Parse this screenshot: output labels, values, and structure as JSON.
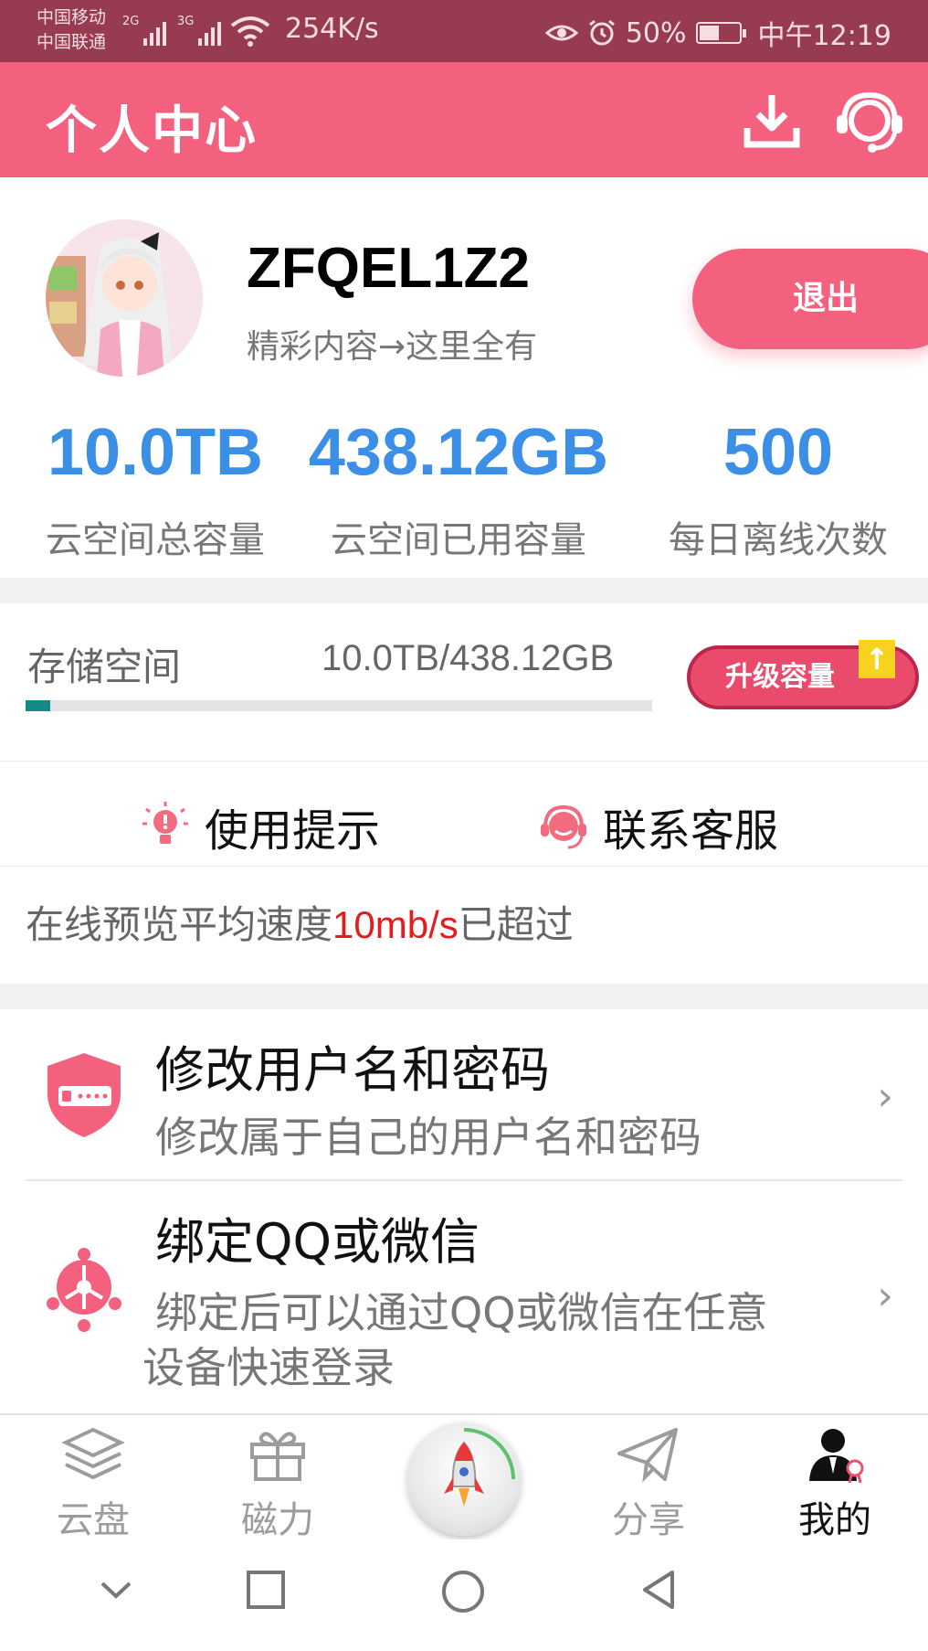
{
  "status_bar": {
    "carrier1": "中国移动",
    "carrier2": "中国联通",
    "net1": "2G",
    "net2": "3G",
    "speed": "254K/s",
    "battery": "50%",
    "time": "中午12:19"
  },
  "header": {
    "title": "个人中心",
    "icons": [
      "download-icon",
      "customer-service-icon"
    ]
  },
  "profile": {
    "username": "ZFQEL1Z2",
    "slogan": "精彩内容→这里全有",
    "logout_label": "退出"
  },
  "stats": [
    {
      "value": "10.0TB",
      "label": "云空间总容量"
    },
    {
      "value": "438.12GB",
      "label": "云空间已用容量"
    },
    {
      "value": "500",
      "label": "每日离线次数"
    }
  ],
  "storage": {
    "label": "存储空间",
    "value": "10.0TB/438.12GB",
    "used_fraction": 0.04,
    "upgrade_label": "升级容量",
    "bar_color": "#168a86"
  },
  "tips": {
    "usage_tips": "使用提示",
    "contact_support": "联系客服"
  },
  "notice": {
    "prefix": "在线预览平均速度",
    "highlight": "10mb/s",
    "suffix": "已超过"
  },
  "menu": [
    {
      "title": "修改用户名和密码",
      "desc": "修改属于自己的用户名和密码",
      "icon": "shield-password-icon"
    },
    {
      "title": "绑定QQ或微信",
      "desc_line1": "绑定后可以通过QQ或微信在任意",
      "desc_line2": "设备快速登录",
      "icon": "share-network-icon"
    }
  ],
  "bottom_nav": [
    {
      "label": "云盘",
      "icon": "layers-icon",
      "active": false
    },
    {
      "label": "磁力",
      "icon": "gift-icon",
      "active": false
    },
    {
      "label": "",
      "icon": "rocket-icon",
      "active": false
    },
    {
      "label": "分享",
      "icon": "paper-plane-icon",
      "active": false
    },
    {
      "label": "我的",
      "icon": "user-icon",
      "active": true
    }
  ],
  "colors": {
    "accent": "#f4617f",
    "status_bar": "#973b50",
    "stat_value": "#3b8fe6",
    "highlight": "#e61b1b"
  }
}
